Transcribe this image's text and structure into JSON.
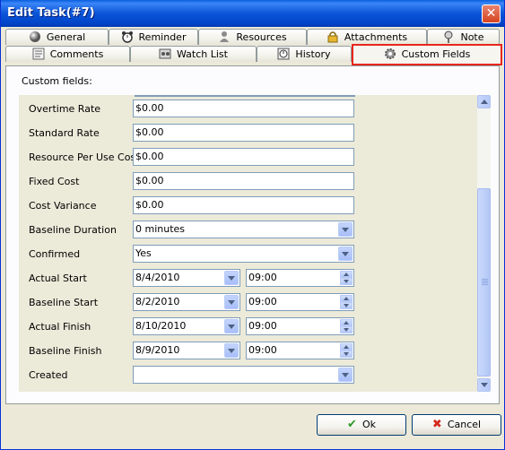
{
  "window": {
    "title": "Edit Task(#7)",
    "close_glyph": "✕"
  },
  "tabs_row1": [
    {
      "label": "General",
      "icon": "sphere-icon"
    },
    {
      "label": "Reminder",
      "icon": "alarm-clock-icon"
    },
    {
      "label": "Resources",
      "icon": "person-icon"
    },
    {
      "label": "Attachments",
      "icon": "lock-icon"
    },
    {
      "label": "Note",
      "icon": "pushpin-icon"
    }
  ],
  "tabs_row2": [
    {
      "label": "Comments",
      "icon": "comments-icon"
    },
    {
      "label": "Watch List",
      "icon": "watch-list-icon"
    },
    {
      "label": "History",
      "icon": "history-icon"
    },
    {
      "label": "Custom Fields",
      "icon": "gear-icon",
      "active": true
    }
  ],
  "panel": {
    "label": "Custom fields:"
  },
  "fields": {
    "overtime_rate": {
      "label": "Overtime Rate",
      "value": "$0.00"
    },
    "standard_rate": {
      "label": "Standard Rate",
      "value": "$0.00"
    },
    "resource_per_use_cost": {
      "label": "Resource Per Use Cost",
      "value": "$0.00"
    },
    "fixed_cost": {
      "label": "Fixed Cost",
      "value": "$0.00"
    },
    "cost_variance": {
      "label": "Cost Variance",
      "value": "$0.00"
    },
    "baseline_duration": {
      "label": "Baseline Duration",
      "value": "0 minutes"
    },
    "confirmed": {
      "label": "Confirmed",
      "value": "Yes"
    },
    "actual_start": {
      "label": "Actual Start",
      "date": "8/4/2010",
      "time": "09:00"
    },
    "baseline_start": {
      "label": "Baseline Start",
      "date": "8/2/2010",
      "time": "09:00"
    },
    "actual_finish": {
      "label": "Actual Finish",
      "date": "8/10/2010",
      "time": "09:00"
    },
    "baseline_finish": {
      "label": "Baseline Finish",
      "date": "8/9/2010",
      "time": "09:00"
    },
    "created": {
      "label": "Created",
      "value": ""
    }
  },
  "buttons": {
    "ok": {
      "label": "Ok",
      "glyph": "✔",
      "color": "#2e9a2a"
    },
    "cancel": {
      "label": "Cancel",
      "glyph": "✖",
      "color": "#d42a1e"
    }
  },
  "colors": {
    "title_bar": "#0b55d8",
    "active_tab_highlight": "#e8261c",
    "fields_background": "#ecead9"
  }
}
